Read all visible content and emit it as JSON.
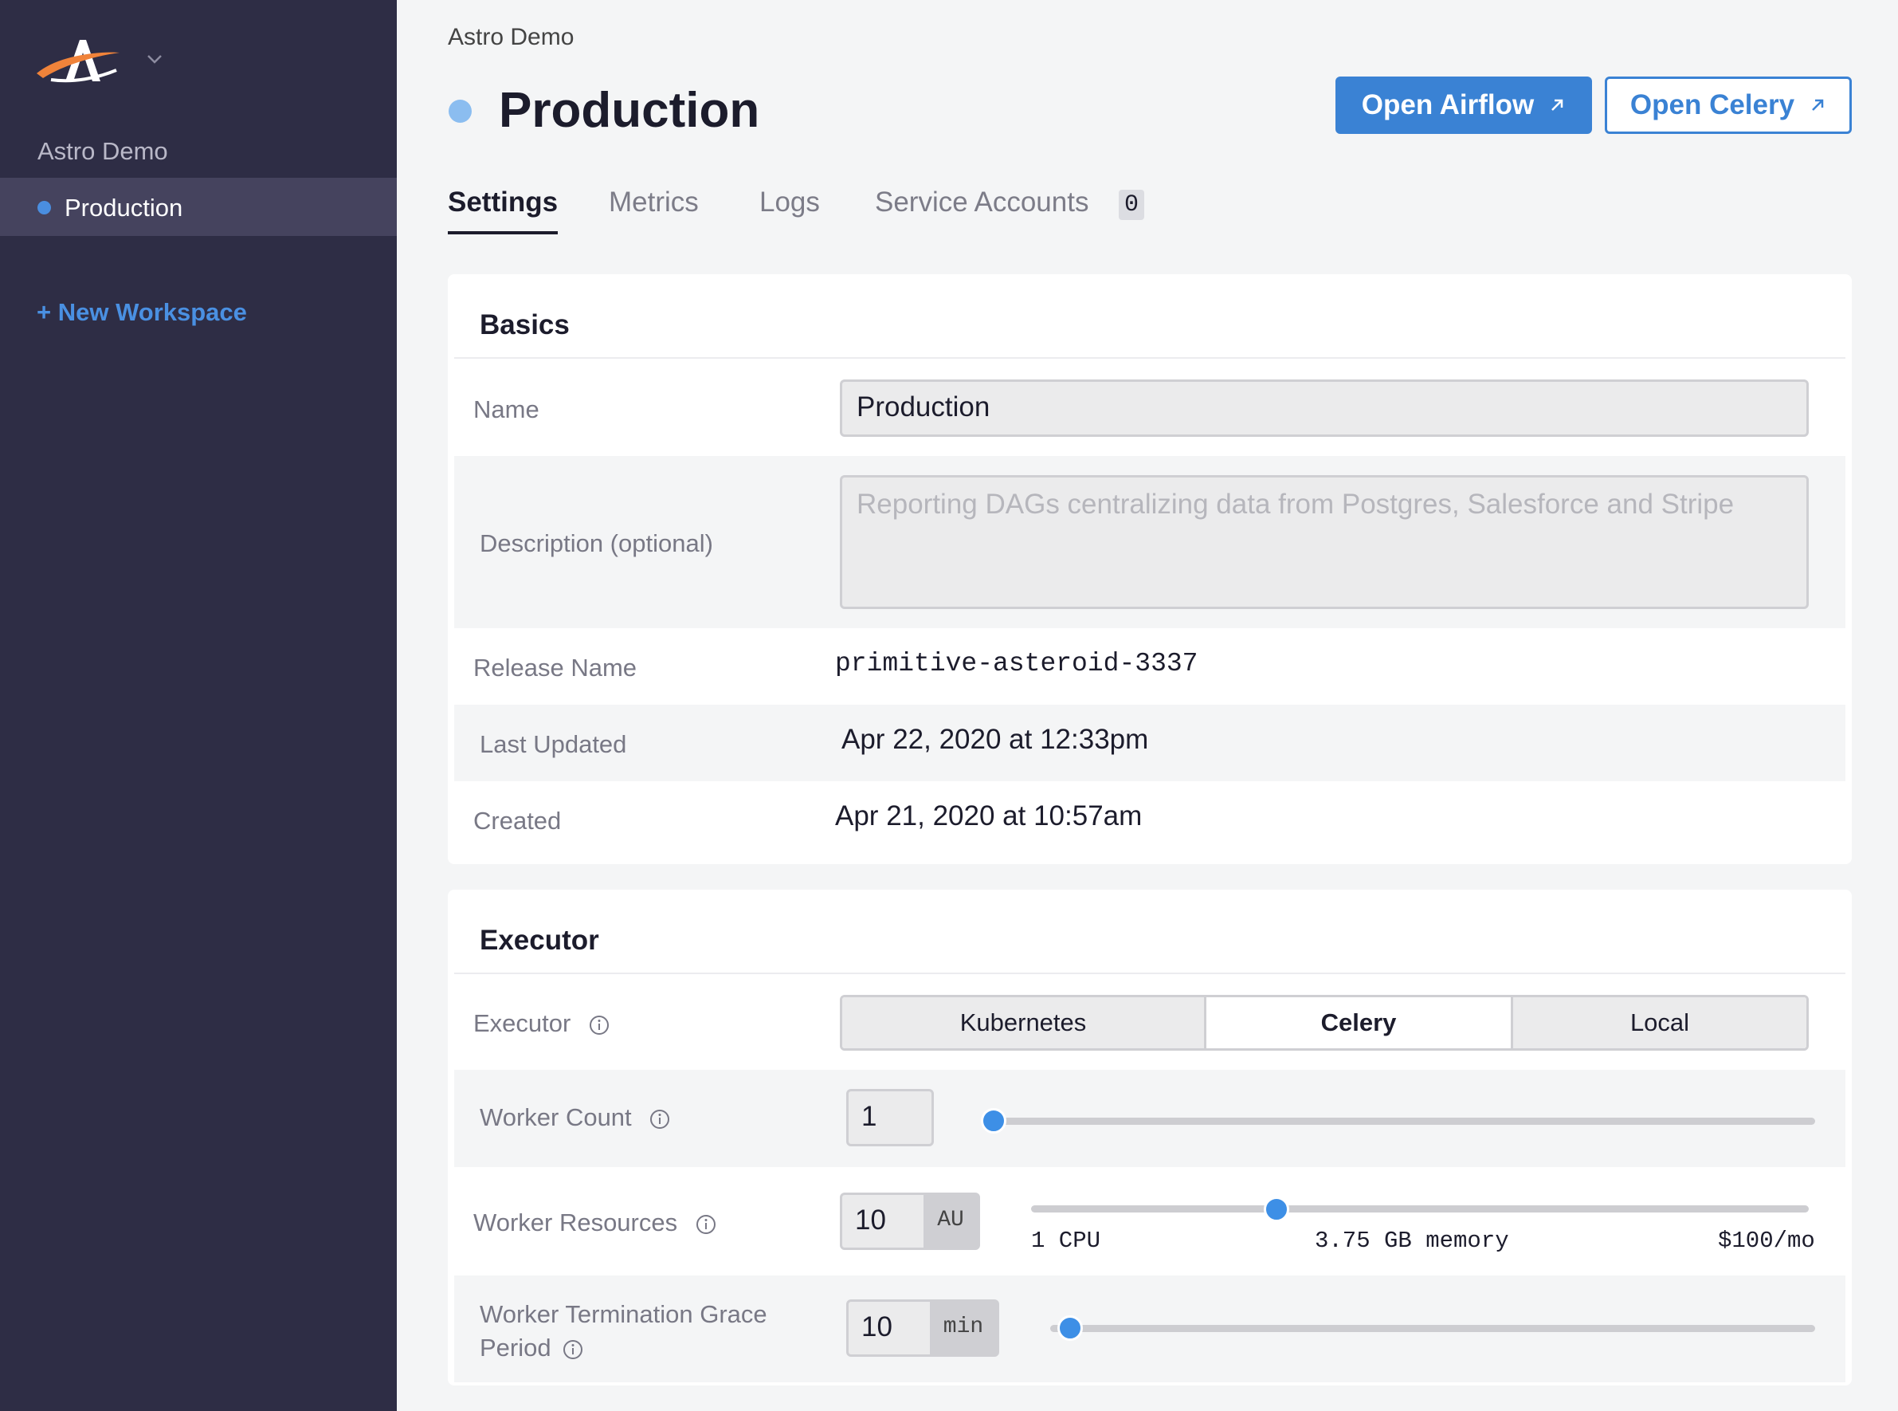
{
  "sidebar": {
    "workspace_name": "Astro Demo",
    "active_item": "Production",
    "new_workspace": "+ New Workspace"
  },
  "header": {
    "breadcrumb": "Astro Demo",
    "title": "Production",
    "open_airflow": "Open Airflow",
    "open_celery": "Open Celery"
  },
  "tabs": [
    {
      "label": "Settings",
      "active": true
    },
    {
      "label": "Metrics"
    },
    {
      "label": "Logs"
    },
    {
      "label": "Service Accounts",
      "badge": "0"
    }
  ],
  "basics": {
    "title": "Basics",
    "name_label": "Name",
    "name_value": "Production",
    "description_label": "Description (optional)",
    "description_placeholder": "Reporting DAGs centralizing data from Postgres, Salesforce and Stripe",
    "release_label": "Release Name",
    "release_value": "primitive-asteroid-3337",
    "updated_label": "Last Updated",
    "updated_value": "Apr 22, 2020 at 12:33pm",
    "created_label": "Created",
    "created_value": "Apr 21, 2020 at 10:57am"
  },
  "executor": {
    "title": "Executor",
    "executor_label": "Executor",
    "options": [
      "Kubernetes",
      "Celery",
      "Local"
    ],
    "selected": "Celery",
    "worker_count_label": "Worker Count",
    "worker_count_value": "1",
    "worker_resources_label": "Worker Resources",
    "worker_resources_value": "10",
    "worker_resources_unit": "AU",
    "cpu_label": "1 CPU",
    "memory_label": "3.75 GB memory",
    "cost_label": "$100/mo",
    "grace_label_line1": "Worker Termination Grace",
    "grace_label_line2": "Period",
    "grace_value": "10",
    "grace_unit": "min"
  },
  "colors": {
    "sidebar_bg": "#2e2d45",
    "accent": "#3a82d4",
    "status_dot": "#8bbdf0",
    "slider_thumb": "#3d8fe6"
  }
}
